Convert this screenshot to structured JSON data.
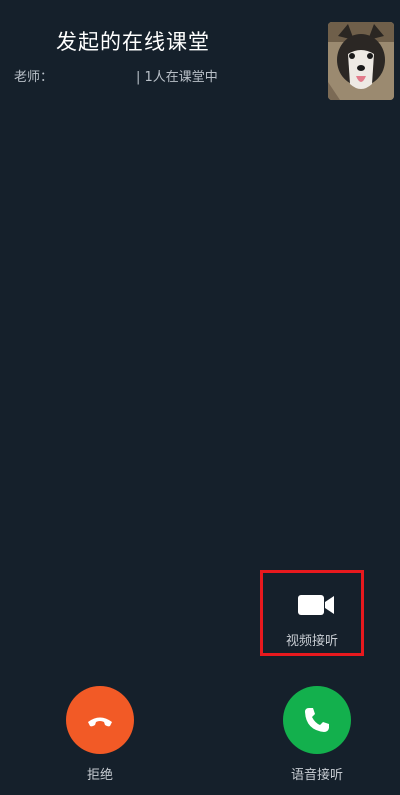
{
  "header": {
    "title": "发起的在线课堂",
    "teacher_label": "老师：",
    "participant_count": "| 1人在课堂中"
  },
  "actions": {
    "video_answer_label": "视频接听",
    "decline_label": "拒绝",
    "voice_answer_label": "语音接听"
  },
  "icons": {
    "video": "video-camera-icon",
    "decline": "hang-up-phone-icon",
    "voice": "phone-icon"
  },
  "colors": {
    "background": "#15202b",
    "decline": "#f25a26",
    "voice_answer": "#13b04d",
    "highlight_box": "#e8191e"
  }
}
